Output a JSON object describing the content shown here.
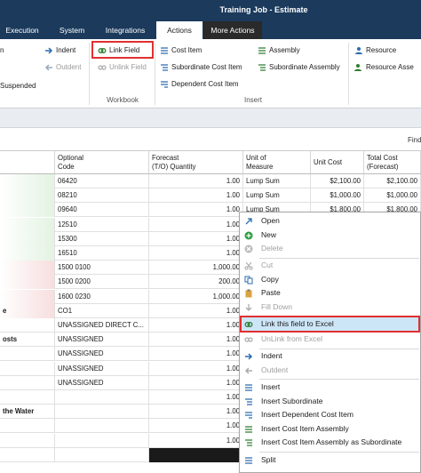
{
  "window": {
    "title": "Training Job - Estimate"
  },
  "tabs": [
    {
      "label": "Execution"
    },
    {
      "label": "System"
    },
    {
      "label": "Integrations"
    },
    {
      "label": "Actions"
    },
    {
      "label": "More Actions"
    }
  ],
  "ribbon": {
    "left": {
      "item1": "n",
      "item3": "Suspended"
    },
    "indent": "Indent",
    "outdent": "Outdent",
    "link_field": "Link Field",
    "unlink_field": "Unlink Field",
    "workbook_label": "Workbook",
    "cost_item": "Cost Item",
    "subordinate_cost_item": "Subordinate Cost Item",
    "dependent_cost_item": "Dependent Cost Item",
    "assembly": "Assembly",
    "subordinate_assembly": "Subordinate Assembly",
    "insert_label": "Insert",
    "resource": "Resource",
    "resource_assembly": "Resource Asse"
  },
  "find_label": "Find",
  "columns": {
    "optional_code": [
      "Optional",
      "Code"
    ],
    "forecast_qty": [
      "Forecast",
      "(T/O) Quantity"
    ],
    "uom": [
      "Unit of",
      "Measure"
    ],
    "unit_cost": "Unit Cost",
    "total_cost": [
      "Total Cost",
      "(Forecast)"
    ]
  },
  "rows": [
    {
      "left": "",
      "code": "06420",
      "qty": "1.00",
      "uom": "Lump Sum",
      "unit": "$2,100.00",
      "total": "$2,100.00"
    },
    {
      "left": "",
      "code": "08210",
      "qty": "1.00",
      "uom": "Lump Sum",
      "unit": "$1,000.00",
      "total": "$1,000.00"
    },
    {
      "left": "",
      "code": "09640",
      "qty": "1.00",
      "uom": "Lump Sum",
      "unit": "$1,800.00",
      "total": "$1,800.00"
    },
    {
      "left": "",
      "code": "12510",
      "qty": "1.00",
      "uom": "",
      "unit": "",
      "total": ""
    },
    {
      "left": "",
      "code": "15300",
      "qty": "1.00",
      "uom": "",
      "unit": "",
      "total": ""
    },
    {
      "left": "",
      "code": "16510",
      "qty": "1.00",
      "uom": "",
      "unit": "",
      "total": ""
    },
    {
      "left": "",
      "code": "1500 0100",
      "qty": "1,000.00",
      "uom": "",
      "unit": "",
      "total": ""
    },
    {
      "left": "",
      "code": "1500 0200",
      "qty": "200.00",
      "uom": "",
      "unit": "",
      "total": ""
    },
    {
      "left": "",
      "code": "1600 0230",
      "qty": "1,000.00",
      "uom": "",
      "unit": "",
      "total": ""
    },
    {
      "left": "e",
      "code": "CO1",
      "qty": "1.00",
      "uom": "",
      "unit": "",
      "total": ""
    },
    {
      "left": "",
      "code": "UNASSIGNED DIRECT C...",
      "qty": "1.00",
      "uom": "",
      "unit": "",
      "total": ""
    },
    {
      "left": "osts",
      "code": "UNASSIGNED",
      "qty": "1.00",
      "uom": "",
      "unit": "",
      "total": ""
    },
    {
      "left": "",
      "code": "UNASSIGNED",
      "qty": "1.00",
      "uom": "",
      "unit": "",
      "total": ""
    },
    {
      "left": "",
      "code": "UNASSIGNED",
      "qty": "1.00",
      "uom": "",
      "unit": "",
      "total": ""
    },
    {
      "left": "",
      "code": "UNASSIGNED",
      "qty": "1.00",
      "uom": "",
      "unit": "",
      "total": ""
    },
    {
      "left": "",
      "code": "",
      "qty": "1.00",
      "uom": "",
      "unit": "",
      "total": ""
    },
    {
      "left": "the Water",
      "code": "",
      "qty": "1.00",
      "uom": "",
      "unit": "",
      "total": ""
    },
    {
      "left": "",
      "code": "",
      "qty": "1.00",
      "uom": "",
      "unit": "",
      "total": ""
    },
    {
      "left": "",
      "code": "",
      "qty": "1.00",
      "uom": "",
      "unit": "",
      "total": ""
    },
    {
      "left": "",
      "code": "",
      "qty": "1.00",
      "uom": "",
      "unit": "",
      "total": ""
    }
  ],
  "context_menu": {
    "open": "Open",
    "new": "New",
    "delete": "Delete",
    "cut": "Cut",
    "copy": "Copy",
    "paste": "Paste",
    "fill_down": "Fill Down",
    "link_excel": "Link this field to Excel",
    "unlink_excel": "UnLink from Excel",
    "indent": "Indent",
    "outdent": "Outdent",
    "insert": "Insert",
    "insert_subordinate": "Insert Subordinate",
    "insert_dependent": "Insert Dependent Cost Item",
    "insert_assembly": "Insert Cost Item Assembly",
    "insert_assembly_sub": "Insert Cost Item Assembly as Subordinate",
    "split": "Split"
  },
  "colors": {
    "titlebar": "#1b3a5c",
    "highlight_border": "#e03030",
    "menu_highlight": "#cde6f7",
    "row_green": "#e3f3e3",
    "row_red": "#f7dede"
  }
}
